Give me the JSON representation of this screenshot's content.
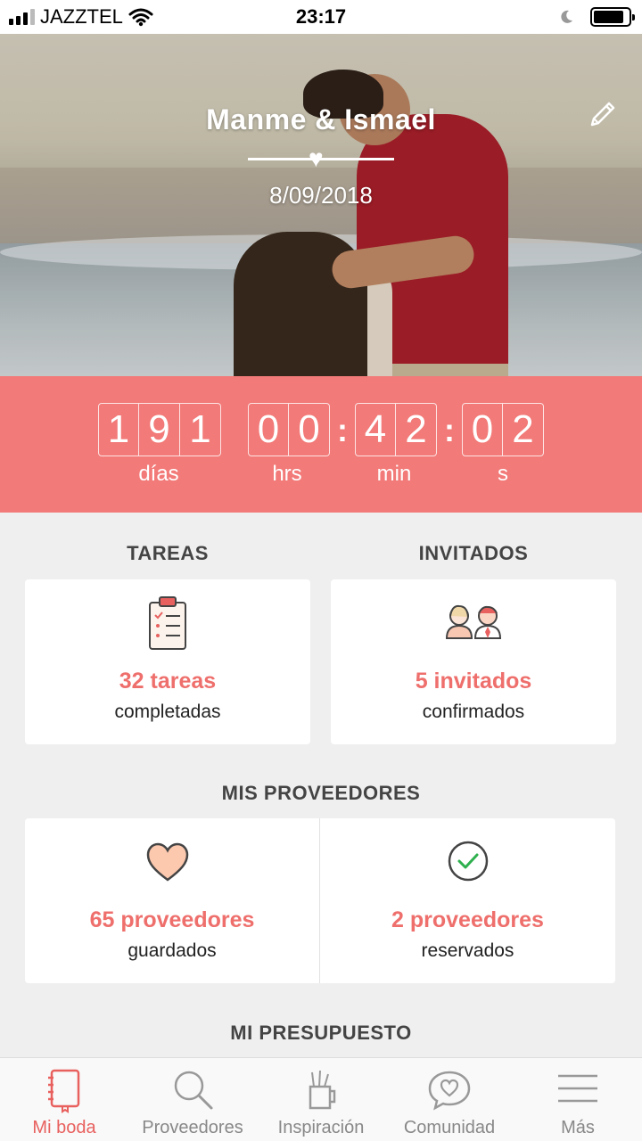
{
  "status_bar": {
    "carrier": "JAZZTEL",
    "time": "23:17"
  },
  "hero": {
    "couple_name": "Manme & Ismael",
    "date": "8/09/2018"
  },
  "countdown": {
    "days": [
      "1",
      "9",
      "1"
    ],
    "hours": [
      "0",
      "0"
    ],
    "minutes": [
      "4",
      "2"
    ],
    "seconds": [
      "0",
      "2"
    ],
    "separator": ":",
    "labels": {
      "days": "días",
      "hours": "hrs",
      "minutes": "min",
      "seconds": "s"
    }
  },
  "tasks": {
    "title": "TAREAS",
    "value": "32 tareas",
    "subtitle": "completadas"
  },
  "guests": {
    "title": "INVITADOS",
    "value": "5 invitados",
    "subtitle": "confirmados"
  },
  "vendors": {
    "title": "MIS PROVEEDORES",
    "saved_value": "65 proveedores",
    "saved_subtitle": "guardados",
    "booked_value": "2 proveedores",
    "booked_subtitle": "reservados"
  },
  "budget": {
    "title": "MI PRESUPUESTO"
  },
  "bottom_nav": {
    "items": [
      {
        "label": "Mi boda",
        "icon": "notebook-icon",
        "active": true
      },
      {
        "label": "Proveedores",
        "icon": "search-icon",
        "active": false
      },
      {
        "label": "Inspiración",
        "icon": "inspiration-icon",
        "active": false
      },
      {
        "label": "Comunidad",
        "icon": "chat-heart-icon",
        "active": false
      },
      {
        "label": "Más",
        "icon": "menu-icon",
        "active": false
      }
    ]
  },
  "colors": {
    "accent": "#f27a78",
    "accent_text": "#ee6f6c",
    "background": "#efefef"
  }
}
